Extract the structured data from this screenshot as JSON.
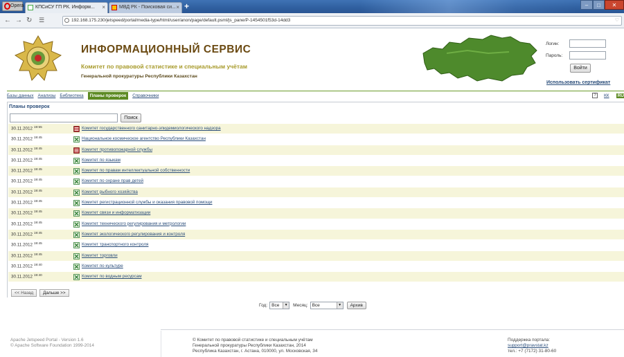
{
  "browser": {
    "opera_label": "Opera",
    "tabs": [
      {
        "label": "КПСиСУ ГП РК. Информ..."
      },
      {
        "label": "МВД РК - Поисковая си..."
      }
    ],
    "url": "192.168.175.230/jetspeed/portal/media-type/html/user/anon/page/default.psml/js_pane/P-1454501f53d-14dd3"
  },
  "header": {
    "title": "ИНФОРМАЦИОННЫЙ СЕРВИС",
    "subtitle": "Комитет по правовой статистике и специальным учётам",
    "subtitle2": "Генеральной прокуратуры Республики Казахстан"
  },
  "login": {
    "login_label": "Логин:",
    "password_label": "Пароль:",
    "login_button": "Войти",
    "cert_link": "Использовать сертификат"
  },
  "menu": {
    "items": [
      {
        "label": "Базы данных",
        "active": false
      },
      {
        "label": "Анализы",
        "active": false
      },
      {
        "label": "Библиотека",
        "active": false
      },
      {
        "label": "Планы проверок",
        "active": true
      },
      {
        "label": "Справочники",
        "active": false
      }
    ],
    "help": "?",
    "lang_kk": "КК",
    "lang_ru": "RU"
  },
  "portlet": {
    "title": "Планы проверок",
    "search_button": "Поиск",
    "rows": [
      {
        "date": "30.11.2012",
        "time": "19:55",
        "icon": "pdf",
        "label": "Комитет государственного санитарно-эпидемиологического надзора"
      },
      {
        "date": "30.11.2012",
        "time": "19:45",
        "icon": "xls",
        "label": "Национальное космическое агентство Республики Казахстан"
      },
      {
        "date": "30.11.2012",
        "time": "19:45",
        "icon": "pdf",
        "label": "Комитет противопожарной службы"
      },
      {
        "date": "30.11.2012",
        "time": "19:45",
        "icon": "xls",
        "label": "Комитет по языкам"
      },
      {
        "date": "30.11.2012",
        "time": "19:45",
        "icon": "xls",
        "label": "Комитет по правам интеллектуальной собственности"
      },
      {
        "date": "30.11.2012",
        "time": "19:45",
        "icon": "xls",
        "label": "Комитет по охране прав детей"
      },
      {
        "date": "30.11.2012",
        "time": "19:45",
        "icon": "xls",
        "label": "Комитет рыбного хозяйства"
      },
      {
        "date": "30.11.2012",
        "time": "19:45",
        "icon": "xls",
        "label": "Комитет регистрационной службы и оказания правовой помощи"
      },
      {
        "date": "30.11.2012",
        "time": "19:45",
        "icon": "xls",
        "label": "Комитет связи и информатизации"
      },
      {
        "date": "30.11.2012",
        "time": "19:45",
        "icon": "xls",
        "label": "Комитет технического регулирования и метрологии"
      },
      {
        "date": "30.11.2012",
        "time": "19:45",
        "icon": "xls",
        "label": "Комитет экологического регулирования и контроля"
      },
      {
        "date": "30.11.2012",
        "time": "19:45",
        "icon": "xls",
        "label": "Комитет транспортного контроля"
      },
      {
        "date": "30.11.2012",
        "time": "19:45",
        "icon": "xls",
        "label": "Комитет торговли"
      },
      {
        "date": "30.11.2012",
        "time": "19:40",
        "icon": "xls",
        "label": "Комитет по культуре"
      },
      {
        "date": "30.11.2012",
        "time": "19:40",
        "icon": "xls",
        "label": "Комитет по водным ресурсам"
      }
    ],
    "prev_button": "<< Назад",
    "next_button": "Дальше >>"
  },
  "filter": {
    "year_label": "Год:",
    "year_value": "Все",
    "month_label": "Месяц:",
    "month_value": "Все",
    "archive_button": "Архив"
  },
  "footer": {
    "left_line1": "Apache Jetspeed Portal - Version 1.6",
    "left_line2": "© Apache Software Foundation 1999-2014",
    "center_line1": "© Комитет по правовой статистике и специальным учётам",
    "center_line2": "Генеральной прокуратуры Республики Казахстан, 2014",
    "center_line3": "Республика Казахстан, г. Астана, 010000, ул. Московская, 34",
    "right_line1": "Поддержка портала:",
    "right_email": "support@pravstat.kz",
    "right_phone": "тел.: +7 (7172) 31-80-60"
  },
  "colors": {
    "menu_active": "#5c8a22",
    "link": "#2a4d7a",
    "title": "#6b4a12",
    "subtitle": "#a79a2a",
    "row_stripe": "#f6f5da"
  }
}
